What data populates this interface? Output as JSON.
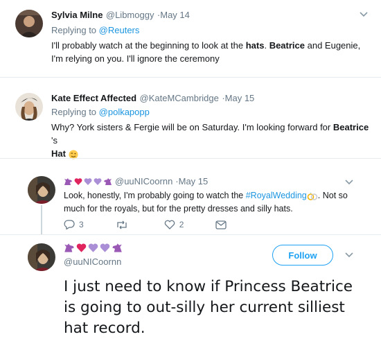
{
  "tweets": [
    {
      "name": "Sylvia Milne",
      "handle": "@Libmoggy",
      "date": "·May 14",
      "reply_prefix": "Replying to ",
      "reply_target": "@Reuters",
      "text": {
        "p1": "I'll probably watch at the beginning to look at the ",
        "b1": "hats",
        "p2": ". ",
        "b2": "Beatrice",
        "p3": " and Eugenie, I'm relying on you. I'll ignore the ceremony"
      }
    },
    {
      "name": "Kate Effect Affected",
      "handle": "@KateMCambridge",
      "date": "·May 15",
      "reply_prefix": "Replying to ",
      "reply_target": "@polkapopp",
      "text": {
        "p1": "Why? York sisters & Fergie will be on Saturday. I'm looking forward for ",
        "b1": "Beatrice",
        "p2": " 's ",
        "b2": "Hat",
        "emoji": "wink-emoji"
      }
    },
    {
      "handle": "@uuNICoornn",
      "date": "·May 15",
      "text": {
        "p1": "Look, honestly, I'm probably going to watch the ",
        "hashtag": "#RoyalWedding",
        "p2": ". Not so much for the royals, but for the pretty dresses and silly hats."
      },
      "actions": {
        "replies": "3",
        "retweets": "",
        "likes": "2"
      }
    },
    {
      "handle": "@uuNICoornn",
      "follow_label": "Follow",
      "text": "I just need to know if Princess Beatrice is going to out-silly her current silliest hat record."
    }
  ],
  "icons": [
    "chevron-down-icon",
    "reply-icon",
    "retweet-icon",
    "like-icon",
    "dm-icon",
    "rings-emoji",
    "unicorn-emoji",
    "heart-emoji",
    "wink-emoji"
  ],
  "colors": {
    "link": "#1b95e0",
    "follow": "#1da1f2",
    "secondary": "#657786",
    "unicorn": "#9b59b6",
    "heart": "#e0245e"
  }
}
